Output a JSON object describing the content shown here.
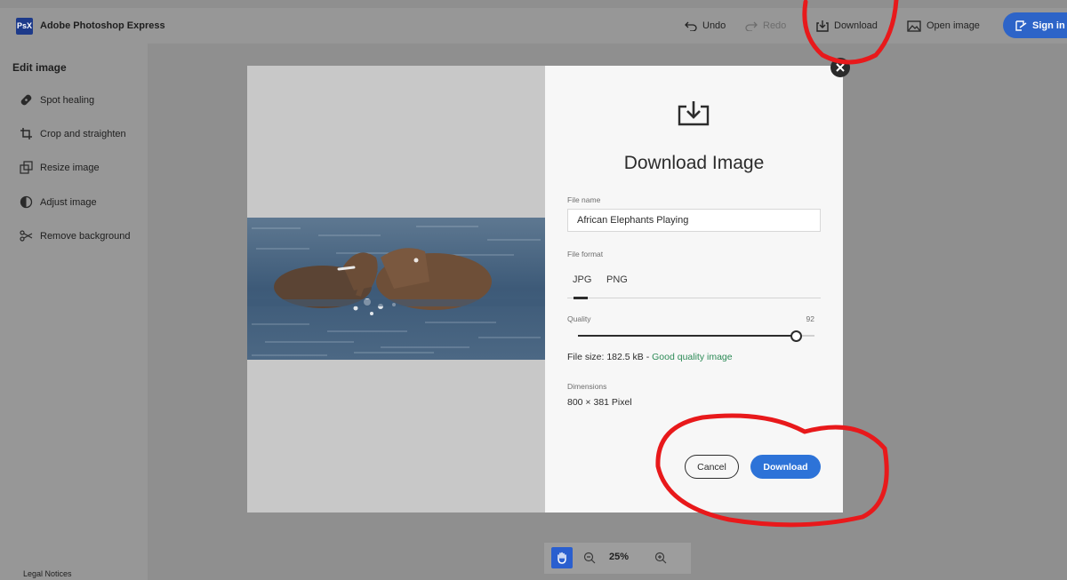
{
  "app": {
    "logo": "PsX",
    "title": "Adobe Photoshop Express"
  },
  "toolbar": {
    "undo": "Undo",
    "redo": "Redo",
    "download": "Download",
    "open_image": "Open image",
    "sign_in": "Sign in"
  },
  "sidebar": {
    "title": "Edit image",
    "items": [
      {
        "label": "Spot healing",
        "icon": "bandage-icon"
      },
      {
        "label": "Crop and straighten",
        "icon": "crop-icon"
      },
      {
        "label": "Resize image",
        "icon": "resize-icon"
      },
      {
        "label": "Adjust image",
        "icon": "adjust-icon"
      },
      {
        "label": "Remove background",
        "icon": "scissors-icon"
      }
    ],
    "legal": "Legal Notices"
  },
  "dialog": {
    "title": "Download Image",
    "file_name_label": "File name",
    "file_name_value": "African Elephants Playing",
    "file_format_label": "File format",
    "formats": [
      "JPG",
      "PNG"
    ],
    "selected_format": "JPG",
    "quality_label": "Quality",
    "quality_value": "92",
    "quality_level": 0.92,
    "file_size_text": "File size: 182.5 kB - ",
    "quality_note": "Good quality image",
    "dimensions_label": "Dimensions",
    "dimensions_value": "800 × 381 Pixel",
    "cancel": "Cancel",
    "download": "Download"
  },
  "zoom": {
    "value": "25%"
  },
  "colors": {
    "accent": "#2d73d8",
    "good": "#2d8b57",
    "annotation": "#e8191b"
  }
}
